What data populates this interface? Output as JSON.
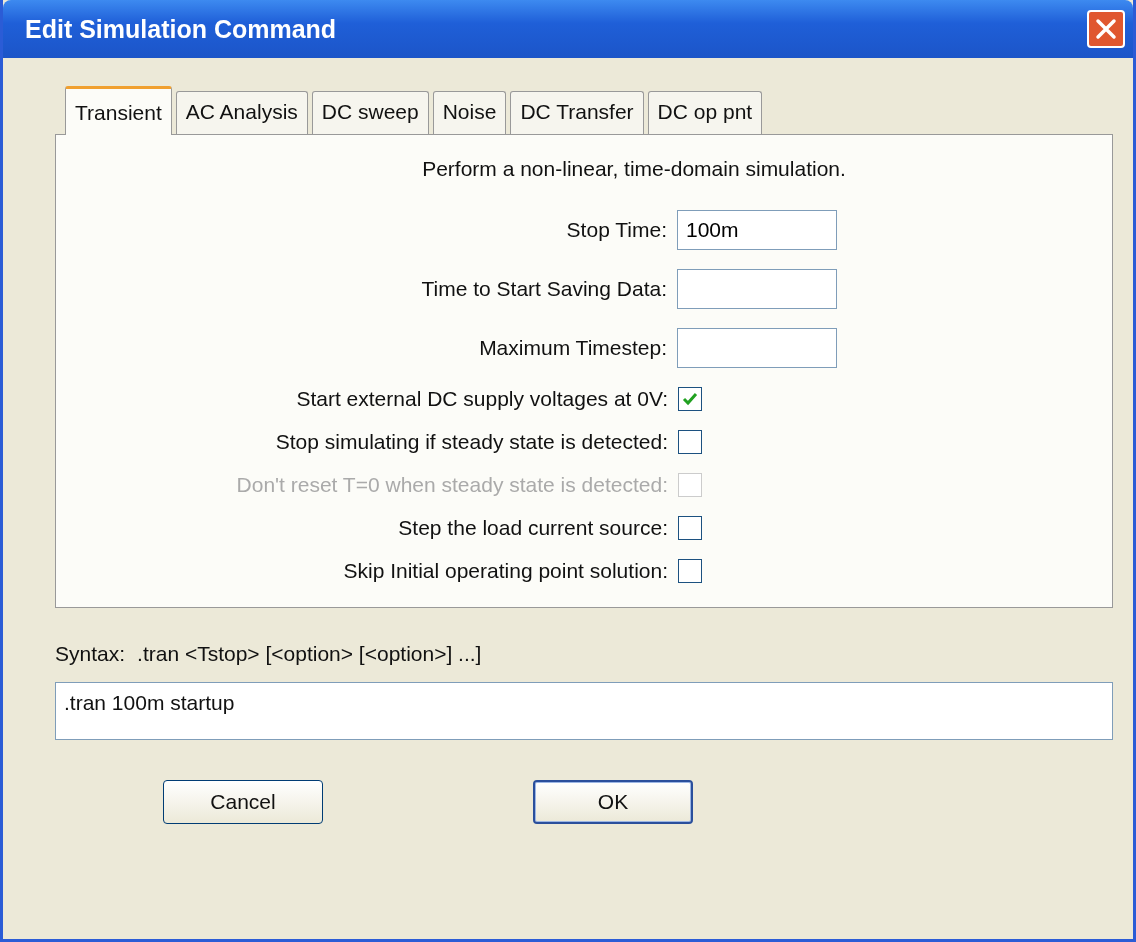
{
  "window": {
    "title": "Edit Simulation Command"
  },
  "tabs": [
    {
      "label": "Transient",
      "selected": true
    },
    {
      "label": "AC Analysis",
      "selected": false
    },
    {
      "label": "DC sweep",
      "selected": false
    },
    {
      "label": "Noise",
      "selected": false
    },
    {
      "label": "DC Transfer",
      "selected": false
    },
    {
      "label": "DC op pnt",
      "selected": false
    }
  ],
  "panel": {
    "description": "Perform a non-linear, time-domain simulation.",
    "fields": [
      {
        "label": "Stop Time:",
        "value": "100m"
      },
      {
        "label": "Time to Start Saving Data:"
      },
      {
        "label": "Maximum Timestep:"
      }
    ],
    "options": [
      {
        "label": "Start external DC supply voltages at 0V:",
        "checked": true,
        "disabled": false
      },
      {
        "label": "Stop simulating if steady state is detected:",
        "checked": false,
        "disabled": false
      },
      {
        "label": "Don't reset T=0 when steady state is detected:",
        "checked": false,
        "disabled": true
      },
      {
        "label": "Step the load current source:",
        "checked": false,
        "disabled": false
      },
      {
        "label": "Skip Initial operating point solution:",
        "checked": false,
        "disabled": false
      }
    ]
  },
  "syntax": {
    "label": "Syntax:",
    "text": ".tran <Tstop> [<option> [<option>] ...]"
  },
  "command": {
    "value": ".tran 100m startup"
  },
  "buttons": [
    {
      "label": "Cancel",
      "default": false
    },
    {
      "label": "OK",
      "default": true
    }
  ]
}
